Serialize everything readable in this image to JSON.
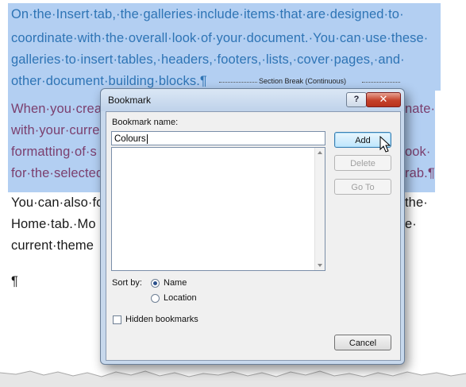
{
  "document": {
    "lines_blue": [
      "On·the·Insert·tab,·the·galleries·include·items·that·are·designed·to·",
      "coordinate·with·the·overall·look·of·your·document.·You·can·use·these·",
      "galleries·to·insert·tables,·headers,·footers,·lists,·cover·pages,·and·",
      "other·document·building·blocks.¶"
    ],
    "section_break": "Section Break (Continuous)",
    "lines_purple": [
      "When·you·crea",
      "with·your·curre",
      "formatting·of·s",
      "for·the·selected"
    ],
    "lines_purple_right": [
      "nate·",
      "",
      "ook·",
      "rab.¶"
    ],
    "lines_black": [
      "You·can·also·fo",
      "Home·tab.·Mo",
      "current·theme"
    ],
    "lines_black_right": [
      "the·",
      "e·",
      ""
    ],
    "empty_paragraph": "¶"
  },
  "dialog": {
    "title": "Bookmark",
    "help_label": "?",
    "close_label": "✕",
    "bookmark_name_label": "Bookmark name:",
    "bookmark_name_value": "Colours",
    "buttons": {
      "add": "Add",
      "delete": "Delete",
      "goto": "Go To",
      "cancel": "Cancel"
    },
    "sort_by_label": "Sort by:",
    "sort_options": [
      "Name",
      "Location"
    ],
    "sort_selected": "Name",
    "hidden_bookmarks_label": "Hidden bookmarks",
    "hidden_bookmarks_checked": false
  },
  "icons": [
    "help-icon",
    "close-icon",
    "mouse-pointer-icon",
    "scroll-up-icon",
    "scroll-down-icon"
  ],
  "colors": {
    "selection": "#b3cff2",
    "text_blue": "#2e74b5",
    "text_purple": "#7b3f6e",
    "dialog_frame": "#c7d8ec",
    "close_red": "#c5412a"
  }
}
